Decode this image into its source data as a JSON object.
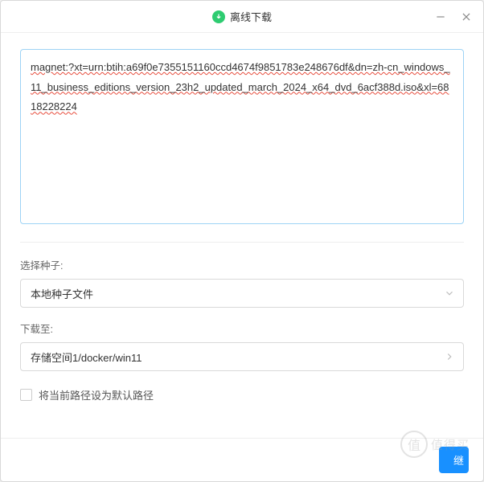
{
  "titlebar": {
    "title": "离线下载"
  },
  "magnet_input": {
    "value": "magnet:?xt=urn:btih:a69f0e7355151160ccd4674f9851783e248676df&dn=zh-cn_windows_11_business_editions_version_23h2_updated_march_2024_x64_dvd_6acf388d.iso&xl=6818228224"
  },
  "seed": {
    "label": "选择种子:",
    "value": "本地种子文件"
  },
  "destination": {
    "label": "下载至:",
    "value": "存储空间1/docker/win11"
  },
  "default_path": {
    "label": "将当前路径设为默认路径"
  },
  "footer": {
    "submit_partial": "继"
  },
  "watermark": {
    "icon": "值",
    "text": "值得买"
  }
}
